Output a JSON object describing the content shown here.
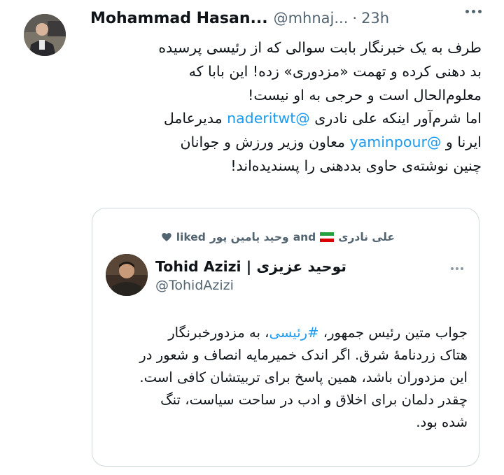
{
  "tweet": {
    "author": {
      "name": "Mohammad Hasan...",
      "handle": "@mhnaj...",
      "separator": "·",
      "time": "23h"
    },
    "text_lines": [
      {
        "segments": [
          {
            "text": "طرف به یک خبرنگار بابت سوالی که از رئیسی پرسیده"
          }
        ]
      },
      {
        "segments": [
          {
            "text": "بد دهنی کرده و تهمت «مزدوری» زده! این بابا که"
          }
        ]
      },
      {
        "segments": [
          {
            "text": "معلوم‌الحال است و حرجی به او نیست!"
          }
        ]
      },
      {
        "segments": [
          {
            "text": "اما شرم‌آور اینکه علی نادری "
          },
          {
            "text": "@naderitwt",
            "mention": true
          },
          {
            "text": " مدیرعامل"
          }
        ]
      },
      {
        "segments": [
          {
            "text": "ایرنا و "
          },
          {
            "text": "@yaminpour",
            "mention": true
          },
          {
            "text": " معاون وزیر ورزش و جوانان"
          }
        ]
      },
      {
        "segments": [
          {
            "text": "چنین نوشته‌ی حاوی بددهنی را پسندیده‌اند!"
          }
        ]
      }
    ]
  },
  "quote": {
    "social_context": {
      "user1": "علی نادری",
      "and_word": "and",
      "user2": "وحید یامین پور",
      "action": "liked"
    },
    "author": {
      "name": "Tohid Azizi | توحید عزیزی",
      "handle": "@TohidAzizi"
    },
    "text_lines": [
      {
        "segments": [
          {
            "text": "جواب متین رئیس جمهور، "
          },
          {
            "text": "#رئیسی",
            "mention": true
          },
          {
            "text": "، به مزدورخبرنگار"
          }
        ]
      },
      {
        "segments": [
          {
            "text": "هتاک زردنامهٔ شرق. اگر اندک خمیرمایه انصاف و شعور در"
          }
        ]
      },
      {
        "segments": [
          {
            "text": "این مزدوران باشد، همین پاسخ برای تربیتشان کافی است."
          }
        ]
      },
      {
        "segments": [
          {
            "text": "چقدر دلمان برای اخلاق و ادب در ساحت سیاست، تنگ"
          }
        ]
      },
      {
        "segments": [
          {
            "text": "شده بود."
          }
        ]
      }
    ]
  },
  "icons": {
    "more": "more-horizontal-icon",
    "liked": "heart-icon",
    "flag": "iran-flag-icon"
  },
  "colors": {
    "link": "#1d9bf0",
    "secondary_text": "#536471",
    "border": "#cfd9de"
  }
}
